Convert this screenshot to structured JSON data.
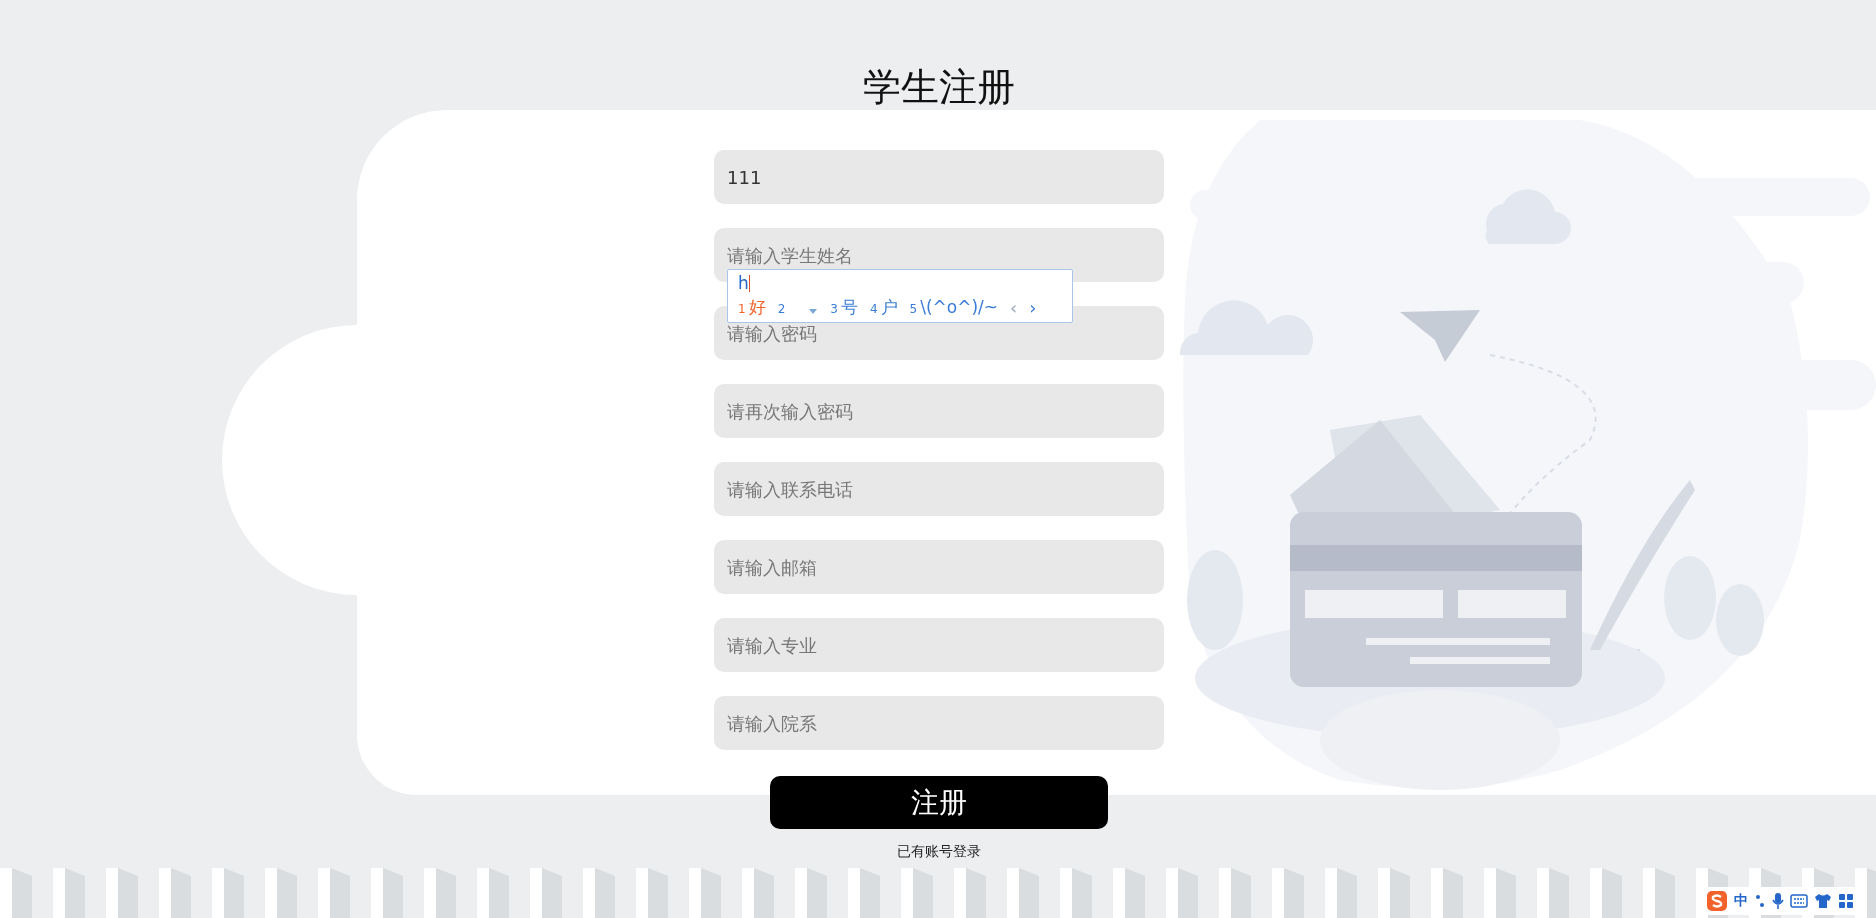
{
  "title": "学生注册",
  "fields": [
    {
      "value": "111"
    },
    {
      "placeholder": "请输入学生姓名"
    },
    {
      "placeholder": "请输入密码"
    },
    {
      "placeholder": "请再次输入密码"
    },
    {
      "placeholder": "请输入联系电话"
    },
    {
      "placeholder": "请输入邮箱"
    },
    {
      "placeholder": "请输入专业"
    },
    {
      "placeholder": "请输入院系"
    }
  ],
  "submit_button": "注册",
  "login_link": "已有账号登录",
  "ime_popup": {
    "composition": "h",
    "candidates": [
      {
        "index": "1",
        "text": "好",
        "selected": true
      },
      {
        "index": "2",
        "selected": false
      },
      {
        "index": "3",
        "text": "号",
        "selected": false
      },
      {
        "index": "4",
        "text": "户",
        "selected": false
      },
      {
        "index": "5",
        "text": "\\(^o^)/~",
        "selected": false
      }
    ],
    "prev": {
      "symbol": "‹",
      "disabled": true
    },
    "next": {
      "symbol": "›",
      "disabled": false
    }
  },
  "ime_toolbar": {
    "mode": "中"
  }
}
